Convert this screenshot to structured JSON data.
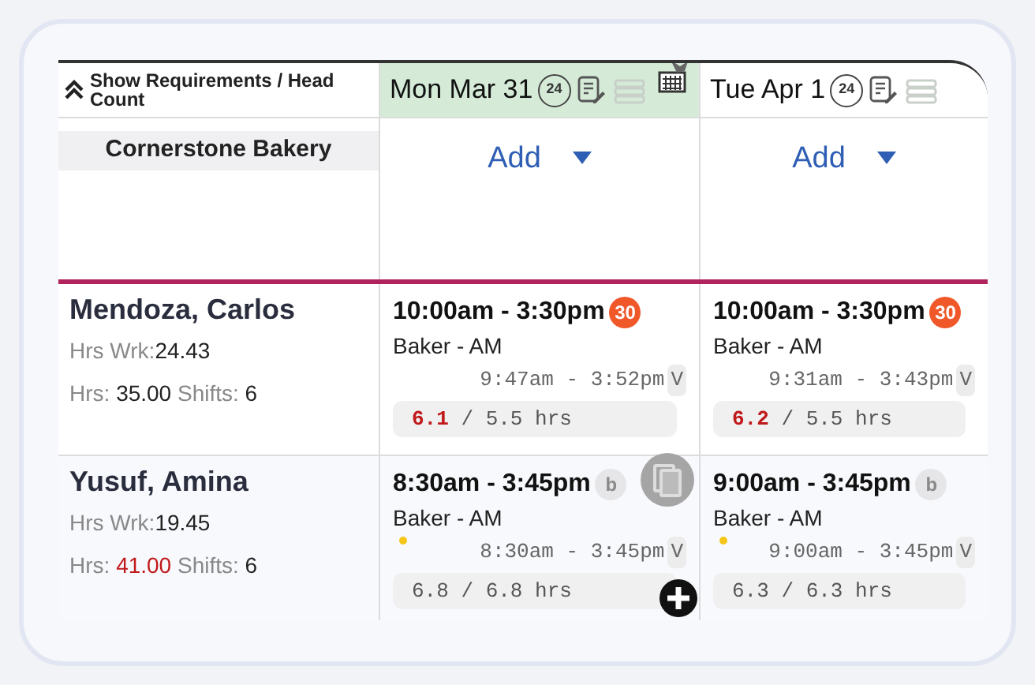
{
  "toggle": {
    "label": "Show Requirements / Head Count",
    "expanded": true
  },
  "location": "Cornerstone Bakery",
  "days": [
    {
      "label": "Mon Mar 31",
      "selected": true,
      "badge": "24",
      "add": "Add"
    },
    {
      "label": "Tue Apr 1",
      "selected": false,
      "badge": "24",
      "add": "Add"
    }
  ],
  "employees": [
    {
      "name": "Mendoza, Carlos",
      "hrs_worked_label": "Hrs Wrk:",
      "hrs_worked": "24.43",
      "hrs_label": "Hrs:",
      "hrs": "35.00",
      "hrs_over": false,
      "shifts_label": "Shifts:",
      "shifts": "6",
      "cells": [
        {
          "time": "10:00am - 3:30pm",
          "badge": {
            "kind": "break",
            "text": "30"
          },
          "role": "Baker - AM",
          "flagged": false,
          "hovered": false,
          "punch": "9:47am - 3:52pm",
          "punch_flag": "V",
          "actual": "6.1",
          "actual_over": true,
          "scheduled": "/ 5.5 hrs"
        },
        {
          "time": "10:00am - 3:30pm",
          "badge": {
            "kind": "break",
            "text": "30"
          },
          "role": "Baker - AM",
          "flagged": false,
          "hovered": false,
          "punch": "9:31am - 3:43pm",
          "punch_flag": "V",
          "actual": "6.2",
          "actual_over": true,
          "scheduled": "/ 5.5 hrs"
        }
      ]
    },
    {
      "name": "Yusuf, Amina",
      "hrs_worked_label": "Hrs Wrk:",
      "hrs_worked": "19.45",
      "hrs_label": "Hrs:",
      "hrs": "41.00",
      "hrs_over": true,
      "shifts_label": "Shifts:",
      "shifts": "6",
      "cells": [
        {
          "time": "8:30am - 3:45pm",
          "badge": {
            "kind": "muted",
            "text": "b"
          },
          "role": "Baker - AM",
          "flagged": true,
          "hovered": true,
          "punch": "8:30am - 3:45pm",
          "punch_flag": "V",
          "actual": "6.8",
          "actual_over": false,
          "scheduled": "/ 6.8 hrs"
        },
        {
          "time": "9:00am - 3:45pm",
          "badge": {
            "kind": "muted",
            "text": "b"
          },
          "role": "Baker - AM",
          "flagged": true,
          "hovered": false,
          "punch": "9:00am - 3:45pm",
          "punch_flag": "V",
          "actual": "6.3",
          "actual_over": false,
          "scheduled": "/ 6.3 hrs"
        }
      ]
    }
  ]
}
